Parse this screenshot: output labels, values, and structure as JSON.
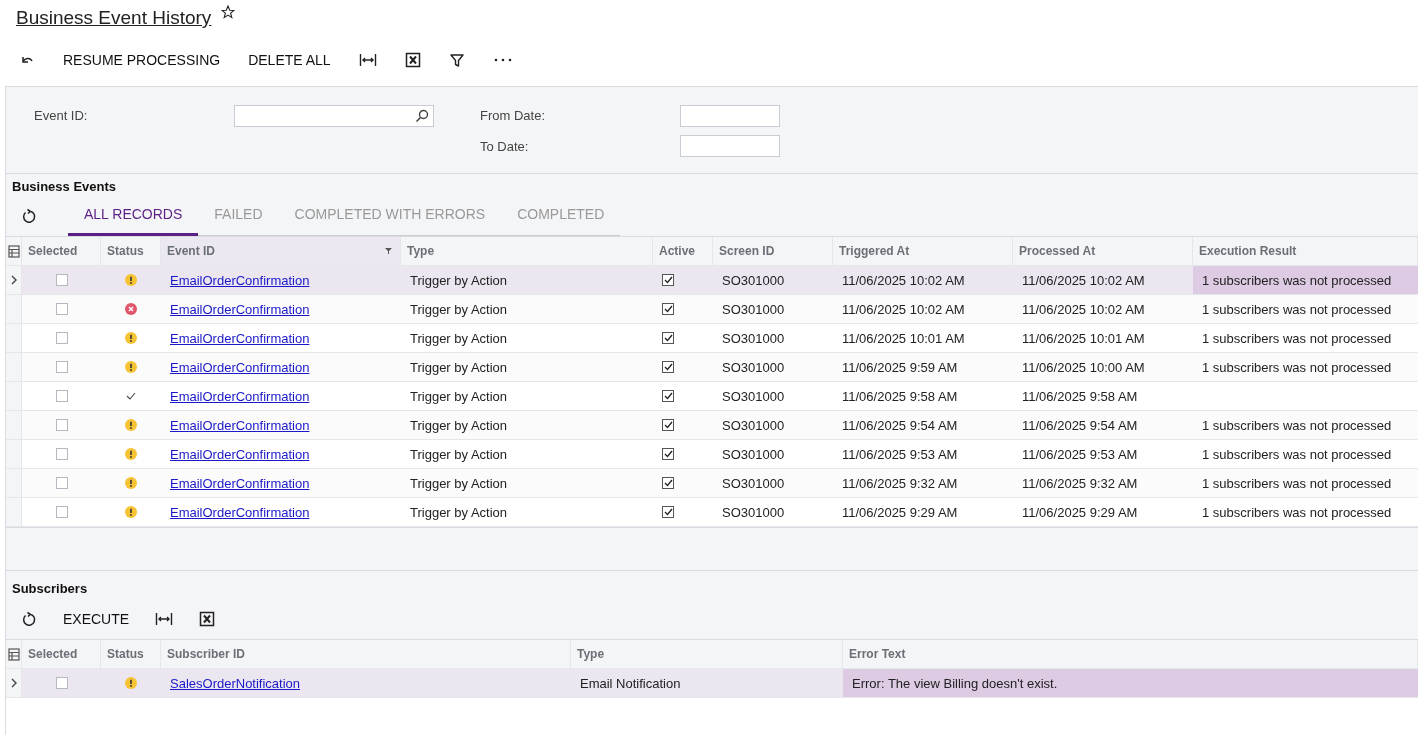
{
  "page": {
    "title": "Business Event History",
    "favorite": false
  },
  "toolbar": {
    "buttons": [
      "RESUME PROCESSING",
      "DELETE ALL"
    ]
  },
  "filters": {
    "event_id": {
      "label": "Event ID:"
    },
    "from_date": {
      "label": "From Date:"
    },
    "to_date": {
      "label": "To Date:"
    }
  },
  "events": {
    "title": "Business Events",
    "tabs": [
      {
        "label": "ALL RECORDS",
        "selected": true
      },
      {
        "label": "FAILED",
        "selected": false
      },
      {
        "label": "COMPLETED WITH ERRORS",
        "selected": false
      },
      {
        "label": "COMPLETED",
        "selected": false
      }
    ],
    "columns": [
      "Selected",
      "Status",
      "Event ID",
      "Type",
      "Active",
      "Screen ID",
      "Triggered At",
      "Processed At",
      "Execution Result"
    ],
    "rows": [
      {
        "selected": true,
        "checked": false,
        "status": {
          "kind": "warning"
        },
        "event_id": "EmailOrderConfirmation",
        "type": "Trigger by Action",
        "active": true,
        "screen_id": "SO301000",
        "triggered_at": "11/06/2025 10:02 AM",
        "processed_at": "11/06/2025 10:02 AM",
        "result": "1 subscribers was not processed"
      },
      {
        "selected": false,
        "checked": false,
        "status": {
          "kind": "error"
        },
        "event_id": "EmailOrderConfirmation",
        "type": "Trigger by Action",
        "active": true,
        "screen_id": "SO301000",
        "triggered_at": "11/06/2025 10:02 AM",
        "processed_at": "11/06/2025 10:02 AM",
        "result": "1 subscribers was not processed"
      },
      {
        "selected": false,
        "checked": false,
        "status": {
          "kind": "warning"
        },
        "event_id": "EmailOrderConfirmation",
        "type": "Trigger by Action",
        "active": true,
        "screen_id": "SO301000",
        "triggered_at": "11/06/2025 10:01 AM",
        "processed_at": "11/06/2025 10:01 AM",
        "result": "1 subscribers was not processed"
      },
      {
        "selected": false,
        "checked": false,
        "status": {
          "kind": "warning"
        },
        "event_id": "EmailOrderConfirmation",
        "type": "Trigger by Action",
        "active": true,
        "screen_id": "SO301000",
        "triggered_at": "11/06/2025 9:59 AM",
        "processed_at": "11/06/2025 10:00 AM",
        "result": "1 subscribers was not processed"
      },
      {
        "selected": false,
        "checked": false,
        "status": {
          "kind": "success"
        },
        "event_id": "EmailOrderConfirmation",
        "type": "Trigger by Action",
        "active": true,
        "screen_id": "SO301000",
        "triggered_at": "11/06/2025 9:58 AM",
        "processed_at": "11/06/2025 9:58 AM"
      },
      {
        "selected": false,
        "checked": false,
        "status": {
          "kind": "warning"
        },
        "event_id": "EmailOrderConfirmation",
        "type": "Trigger by Action",
        "active": true,
        "screen_id": "SO301000",
        "triggered_at": "11/06/2025 9:54 AM",
        "processed_at": "11/06/2025 9:54 AM",
        "result": "1 subscribers was not processed"
      },
      {
        "selected": false,
        "checked": false,
        "status": {
          "kind": "warning"
        },
        "event_id": "EmailOrderConfirmation",
        "type": "Trigger by Action",
        "active": true,
        "screen_id": "SO301000",
        "triggered_at": "11/06/2025 9:53 AM",
        "processed_at": "11/06/2025 9:53 AM",
        "result": "1 subscribers was not processed"
      },
      {
        "selected": false,
        "checked": false,
        "status": {
          "kind": "warning"
        },
        "event_id": "EmailOrderConfirmation",
        "type": "Trigger by Action",
        "active": true,
        "screen_id": "SO301000",
        "triggered_at": "11/06/2025 9:32 AM",
        "processed_at": "11/06/2025 9:32 AM",
        "result": "1 subscribers was not processed"
      },
      {
        "selected": false,
        "checked": false,
        "status": {
          "kind": "warning"
        },
        "event_id": "EmailOrderConfirmation",
        "type": "Trigger by Action",
        "active": true,
        "screen_id": "SO301000",
        "triggered_at": "11/06/2025 9:29 AM",
        "processed_at": "11/06/2025 9:29 AM",
        "result": "1 subscribers was not processed"
      }
    ]
  },
  "subscribers": {
    "title": "Subscribers",
    "buttons": [
      "EXECUTE"
    ],
    "columns": [
      "Selected",
      "Status",
      "Subscriber ID",
      "Type",
      "Error Text"
    ],
    "rows": [
      {
        "selected": true,
        "checked": false,
        "status": {
          "kind": "warning"
        },
        "subscriber_id": "SalesOrderNotification",
        "type": "Email Notification",
        "error_text": "Error: The view Billing doesn't exist."
      }
    ]
  }
}
